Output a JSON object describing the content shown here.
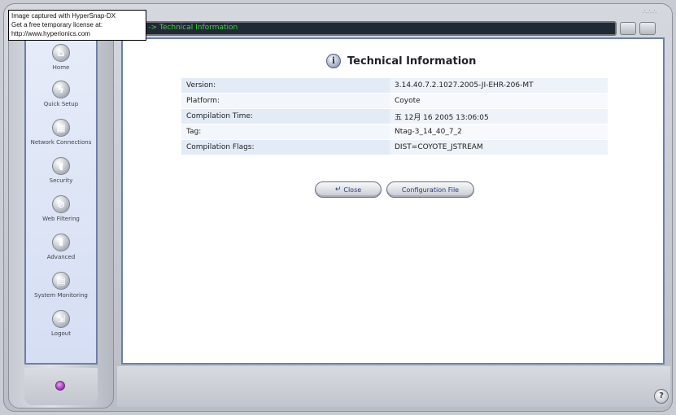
{
  "header": {
    "breadcrumb": "anced -> Technical Information"
  },
  "sidebar": {
    "items": [
      {
        "label": "Home",
        "icon": "home-icon",
        "glyph": "⌂"
      },
      {
        "label": "Quick Setup",
        "icon": "lightning-icon",
        "glyph": "ϟ"
      },
      {
        "label": "Network Connections",
        "icon": "network-icon",
        "glyph": "▦"
      },
      {
        "label": "Security",
        "icon": "shield-icon",
        "glyph": "◖"
      },
      {
        "label": "Web Filtering",
        "icon": "filter-icon",
        "glyph": "⊘"
      },
      {
        "label": "Advanced",
        "icon": "advanced-icon",
        "glyph": "⦀"
      },
      {
        "label": "System Monitoring",
        "icon": "monitor-icon",
        "glyph": "▤"
      },
      {
        "label": "Logout",
        "icon": "logout-icon",
        "glyph": "⇲"
      }
    ]
  },
  "main": {
    "title": "Technical Information",
    "table": [
      {
        "key": "Version:",
        "value": "3.14.40.7.2.1027.2005-JI-EHR-206-MT"
      },
      {
        "key": "Platform:",
        "value": "Coyote"
      },
      {
        "key": "Compilation Time:",
        "value": "五 12月 16 2005 13:06:05"
      },
      {
        "key": "Tag:",
        "value": "Ntag-3_14_40_7_2"
      },
      {
        "key": "Compilation Flags:",
        "value": "DIST=COYOTE_JSTREAM"
      }
    ],
    "buttons": {
      "close": "Close",
      "config": "Configuration File"
    }
  },
  "watermark": {
    "line1": "Image captured with HyperSnap-DX",
    "line2": "Get a free temporary license at:",
    "line3": "http://www.hyperionics.com"
  },
  "colors": {
    "breadcrumb_text": "#3fd13f",
    "sidebar_border": "#6e7fa8",
    "button_text": "#2a3a7a"
  }
}
